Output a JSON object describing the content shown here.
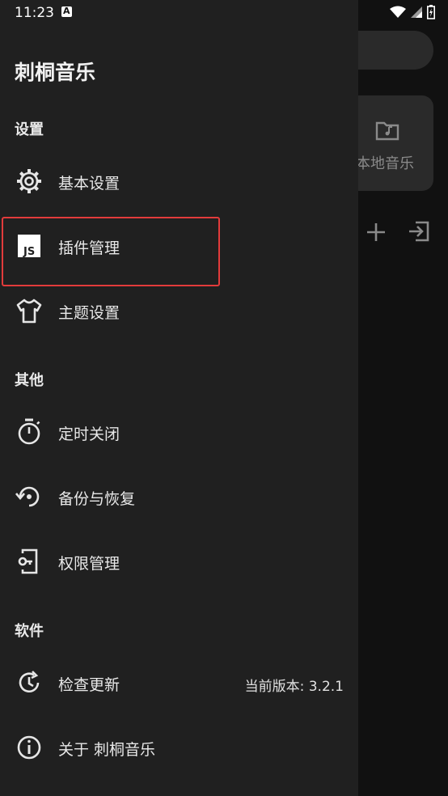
{
  "status_bar": {
    "time": "11:23",
    "notification_glyph": "A"
  },
  "drawer": {
    "app_title": "刺桐音乐",
    "sections": [
      {
        "title": "设置",
        "items": [
          {
            "label": "基本设置",
            "icon": "gear-icon"
          },
          {
            "label": "插件管理",
            "icon": "js-plugin-icon"
          },
          {
            "label": "主题设置",
            "icon": "tshirt-icon"
          }
        ]
      },
      {
        "title": "其他",
        "items": [
          {
            "label": "定时关闭",
            "icon": "timer-icon"
          },
          {
            "label": "备份与恢复",
            "icon": "backup-restore-icon"
          },
          {
            "label": "权限管理",
            "icon": "permission-key-icon"
          }
        ]
      },
      {
        "title": "软件",
        "items": [
          {
            "label": "检查更新",
            "icon": "update-icon",
            "meta": "当前版本: 3.2.1"
          },
          {
            "label": "关于 刺桐音乐",
            "icon": "info-icon"
          }
        ]
      }
    ]
  },
  "background": {
    "local_music_label": "本地音乐"
  },
  "colors": {
    "drawer_bg": "#202020",
    "page_bg": "#111111",
    "highlight": "#e23b3b"
  }
}
